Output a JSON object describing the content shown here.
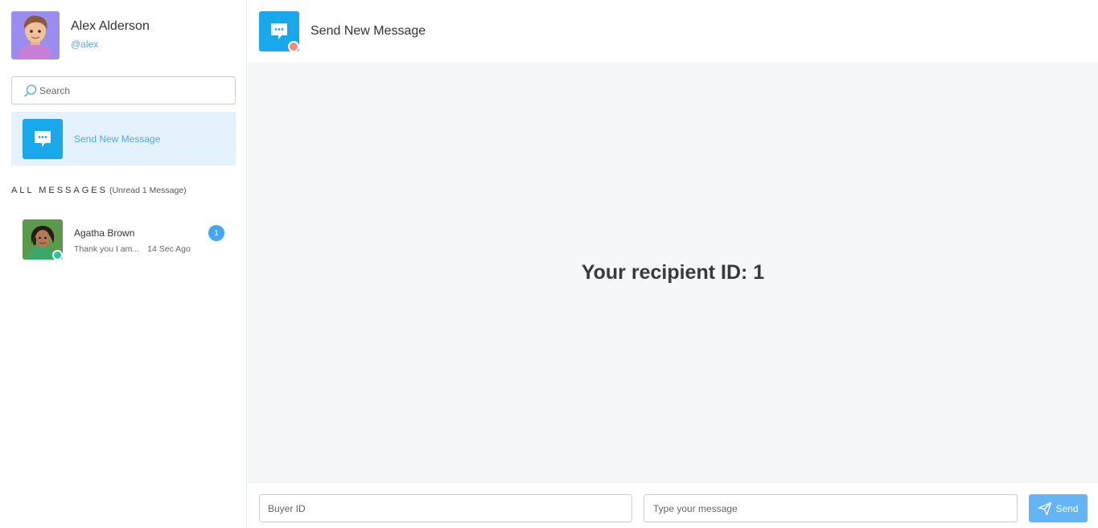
{
  "user": {
    "name": "Alex Alderson",
    "handle": "@alex",
    "avatar_icon": "user-avatar-3d"
  },
  "search": {
    "placeholder": "Search"
  },
  "sidebar": {
    "new_message_label": "Send New Message",
    "all_messages_title": "ALL MESSAGES",
    "unread_text": "(Unread 1 Message)",
    "contacts": [
      {
        "name": "Agatha Brown",
        "preview": "Thank you I am...",
        "time": "14 Sec Ago",
        "unread_count": "1",
        "online": true
      }
    ]
  },
  "header": {
    "title": "Send New Message"
  },
  "conversation": {
    "recipient_text": "Your recipient ID: 1"
  },
  "footer": {
    "buyer_id_placeholder": "Buyer ID",
    "message_placeholder": "Type your message",
    "send_label": "Send"
  },
  "colors": {
    "accent": "#1aa8ec",
    "highlight_bg": "#e3f2fd",
    "badge": "#42a5f5",
    "online": "#26c6a4",
    "away": "#f08a7e",
    "send_button": "#64b5f6"
  }
}
